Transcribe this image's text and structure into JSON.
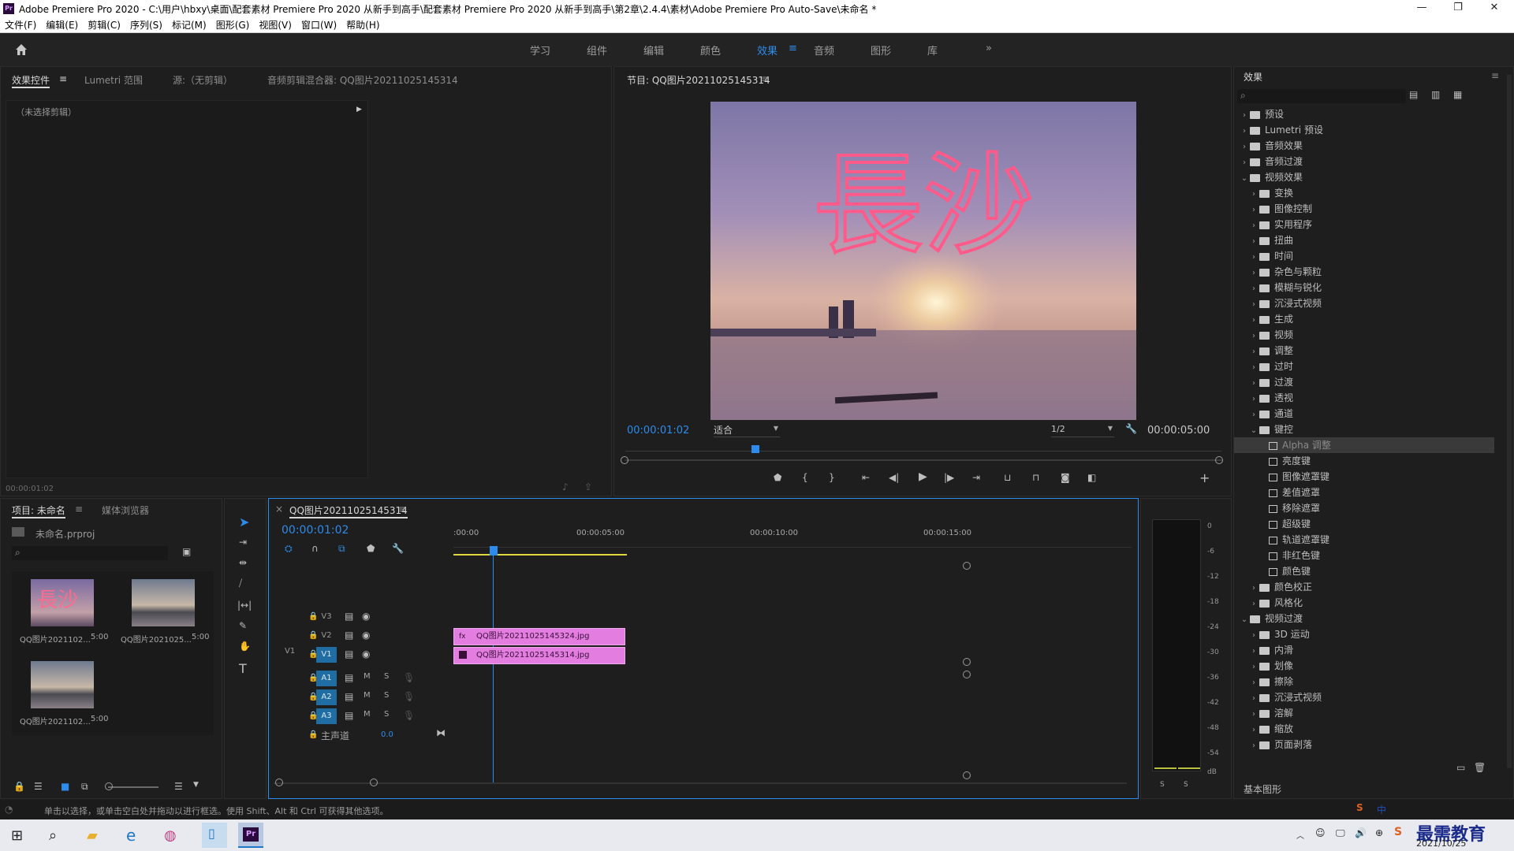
{
  "window": {
    "title": "Adobe Premiere Pro 2020 - C:\\用户\\hbxy\\桌面\\配套素材 Premiere Pro 2020 从新手到高手\\配套素材 Premiere Pro 2020 从新手到高手\\第2章\\2.4.4\\素材\\Adobe Premiere Pro Auto-Save\\未命名 *",
    "app_icon": "Pr"
  },
  "menu": [
    "文件(F)",
    "编辑(E)",
    "剪辑(C)",
    "序列(S)",
    "标记(M)",
    "图形(G)",
    "视图(V)",
    "窗口(W)",
    "帮助(H)"
  ],
  "workspaces": {
    "tabs": [
      "学习",
      "组件",
      "编辑",
      "颜色",
      "效果",
      "音频",
      "图形",
      "库"
    ],
    "active": "效果",
    "more": "»"
  },
  "source_panel": {
    "tabs": [
      "效果控件",
      "Lumetri 范围",
      "源:（无剪辑）",
      "音频剪辑混合器: QQ图片20211025145314"
    ],
    "no_clip": "（未选择剪辑）",
    "timecode": "00:00:01:02"
  },
  "program_monitor": {
    "title": "节目: QQ图片20211025145314",
    "overlay_text": "長沙",
    "timecode": "00:00:01:02",
    "fit": "适合",
    "resolution": "1/2",
    "duration": "00:00:05:00"
  },
  "effects_panel": {
    "title": "效果",
    "footer": "基本图形",
    "tree": [
      {
        "label": "预设",
        "level": 0,
        "open": false,
        "kind": "preset"
      },
      {
        "label": "Lumetri 预设",
        "level": 0,
        "open": false,
        "kind": "preset"
      },
      {
        "label": "音频效果",
        "level": 0,
        "open": false,
        "kind": "folder"
      },
      {
        "label": "音频过渡",
        "level": 0,
        "open": false,
        "kind": "folder"
      },
      {
        "label": "视频效果",
        "level": 0,
        "open": true,
        "kind": "folder"
      },
      {
        "label": "变换",
        "level": 1,
        "open": false,
        "kind": "folder"
      },
      {
        "label": "图像控制",
        "level": 1,
        "open": false,
        "kind": "folder"
      },
      {
        "label": "实用程序",
        "level": 1,
        "open": false,
        "kind": "folder"
      },
      {
        "label": "扭曲",
        "level": 1,
        "open": false,
        "kind": "folder"
      },
      {
        "label": "时间",
        "level": 1,
        "open": false,
        "kind": "folder"
      },
      {
        "label": "杂色与颗粒",
        "level": 1,
        "open": false,
        "kind": "folder"
      },
      {
        "label": "模糊与锐化",
        "level": 1,
        "open": false,
        "kind": "folder"
      },
      {
        "label": "沉浸式视频",
        "level": 1,
        "open": false,
        "kind": "folder"
      },
      {
        "label": "生成",
        "level": 1,
        "open": false,
        "kind": "folder"
      },
      {
        "label": "视频",
        "level": 1,
        "open": false,
        "kind": "folder"
      },
      {
        "label": "调整",
        "level": 1,
        "open": false,
        "kind": "folder"
      },
      {
        "label": "过时",
        "level": 1,
        "open": false,
        "kind": "folder"
      },
      {
        "label": "过渡",
        "level": 1,
        "open": false,
        "kind": "folder"
      },
      {
        "label": "透视",
        "level": 1,
        "open": false,
        "kind": "folder"
      },
      {
        "label": "通道",
        "level": 1,
        "open": false,
        "kind": "folder"
      },
      {
        "label": "键控",
        "level": 1,
        "open": true,
        "kind": "folder"
      },
      {
        "label": "Alpha 调整",
        "level": 2,
        "kind": "fx",
        "selected": true
      },
      {
        "label": "亮度键",
        "level": 2,
        "kind": "fx"
      },
      {
        "label": "图像遮罩键",
        "level": 2,
        "kind": "fx"
      },
      {
        "label": "差值遮罩",
        "level": 2,
        "kind": "fx"
      },
      {
        "label": "移除遮罩",
        "level": 2,
        "kind": "fx"
      },
      {
        "label": "超级键",
        "level": 2,
        "kind": "fx"
      },
      {
        "label": "轨道遮罩键",
        "level": 2,
        "kind": "fx"
      },
      {
        "label": "非红色键",
        "level": 2,
        "kind": "fx"
      },
      {
        "label": "颜色键",
        "level": 2,
        "kind": "fx"
      },
      {
        "label": "颜色校正",
        "level": 1,
        "open": false,
        "kind": "folder"
      },
      {
        "label": "风格化",
        "level": 1,
        "open": false,
        "kind": "folder"
      },
      {
        "label": "视频过渡",
        "level": 0,
        "open": true,
        "kind": "folder"
      },
      {
        "label": "3D 运动",
        "level": 1,
        "open": false,
        "kind": "folder"
      },
      {
        "label": "内滑",
        "level": 1,
        "open": false,
        "kind": "folder"
      },
      {
        "label": "划像",
        "level": 1,
        "open": false,
        "kind": "folder"
      },
      {
        "label": "擦除",
        "level": 1,
        "open": false,
        "kind": "folder"
      },
      {
        "label": "沉浸式视频",
        "level": 1,
        "open": false,
        "kind": "folder"
      },
      {
        "label": "溶解",
        "level": 1,
        "open": false,
        "kind": "folder"
      },
      {
        "label": "缩放",
        "level": 1,
        "open": false,
        "kind": "folder"
      },
      {
        "label": "页面剥落",
        "level": 1,
        "open": false,
        "kind": "folder"
      }
    ]
  },
  "project_panel": {
    "tabs": [
      "项目: 未命名",
      "媒体浏览器"
    ],
    "file": "未命名.prproj",
    "items": [
      {
        "name": "QQ图片2021102...",
        "dur": "5:00",
        "kind": "text"
      },
      {
        "name": "QQ图片2021025...",
        "dur": "5:00",
        "kind": "sunset"
      },
      {
        "name": "QQ图片2021102...",
        "dur": "5:00",
        "kind": "sunset"
      }
    ]
  },
  "timeline": {
    "sequence": "QQ图片20211025145314",
    "timecode": "00:00:01:02",
    "ruler": [
      ":00:00",
      "00:00:05:00",
      "00:00:10:00",
      "00:00:15:00"
    ],
    "tracks": {
      "video": [
        "V3",
        "V2",
        "V1"
      ],
      "source_patch": "V1",
      "audio": [
        "A1",
        "A2",
        "A3"
      ],
      "master": "主声道",
      "master_val": "0.0"
    },
    "clips": [
      {
        "track": "V2",
        "name": "QQ图片20211025145324.jpg",
        "fx": "fx"
      },
      {
        "track": "V1",
        "name": "QQ图片20211025145314.jpg",
        "fx": ""
      }
    ]
  },
  "audio_meter": {
    "labels": [
      "0",
      "-6",
      "-12",
      "-18",
      "-24",
      "-30",
      "-36",
      "-42",
      "-48",
      "-54",
      "dB"
    ],
    "solo": [
      "S",
      "S"
    ]
  },
  "status_bar": "单击以选择，或单击空白处并拖动以进行框选。使用 Shift、Alt 和 Ctrl 可获得其他选项。",
  "taskbar": {
    "date": "2021/10/25",
    "watermark": "最需教育",
    "ime": "中"
  }
}
